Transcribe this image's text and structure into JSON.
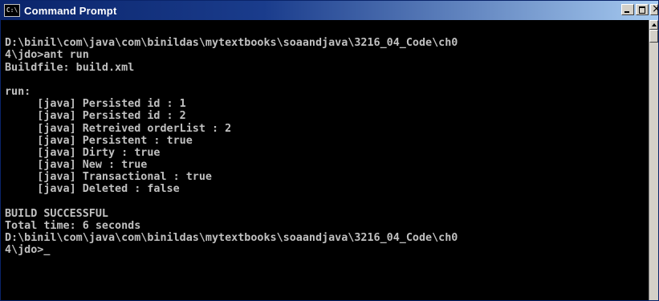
{
  "window": {
    "title": "Command Prompt",
    "icon_text": "C:\\"
  },
  "console": {
    "lines": [
      "",
      "D:\\binil\\com\\java\\com\\binildas\\mytextbooks\\soaandjava\\3216_04_Code\\ch0",
      "4\\jdo>ant run",
      "Buildfile: build.xml",
      "",
      "run:",
      "     [java] Persisted id : 1",
      "     [java] Persisted id : 2",
      "     [java] Retreived orderList : 2",
      "     [java] Persistent : true",
      "     [java] Dirty : true",
      "     [java] New : true",
      "     [java] Transactional : true",
      "     [java] Deleted : false",
      "",
      "BUILD SUCCESSFUL",
      "Total time: 6 seconds",
      "D:\\binil\\com\\java\\com\\binildas\\mytextbooks\\soaandjava\\3216_04_Code\\ch0"
    ],
    "prompt_line": "4\\jdo>",
    "cursor": "_"
  },
  "colors": {
    "background": "#000000",
    "text": "#c0c0c0",
    "titlebar_start": "#0a246a",
    "titlebar_end": "#a6caf0"
  }
}
